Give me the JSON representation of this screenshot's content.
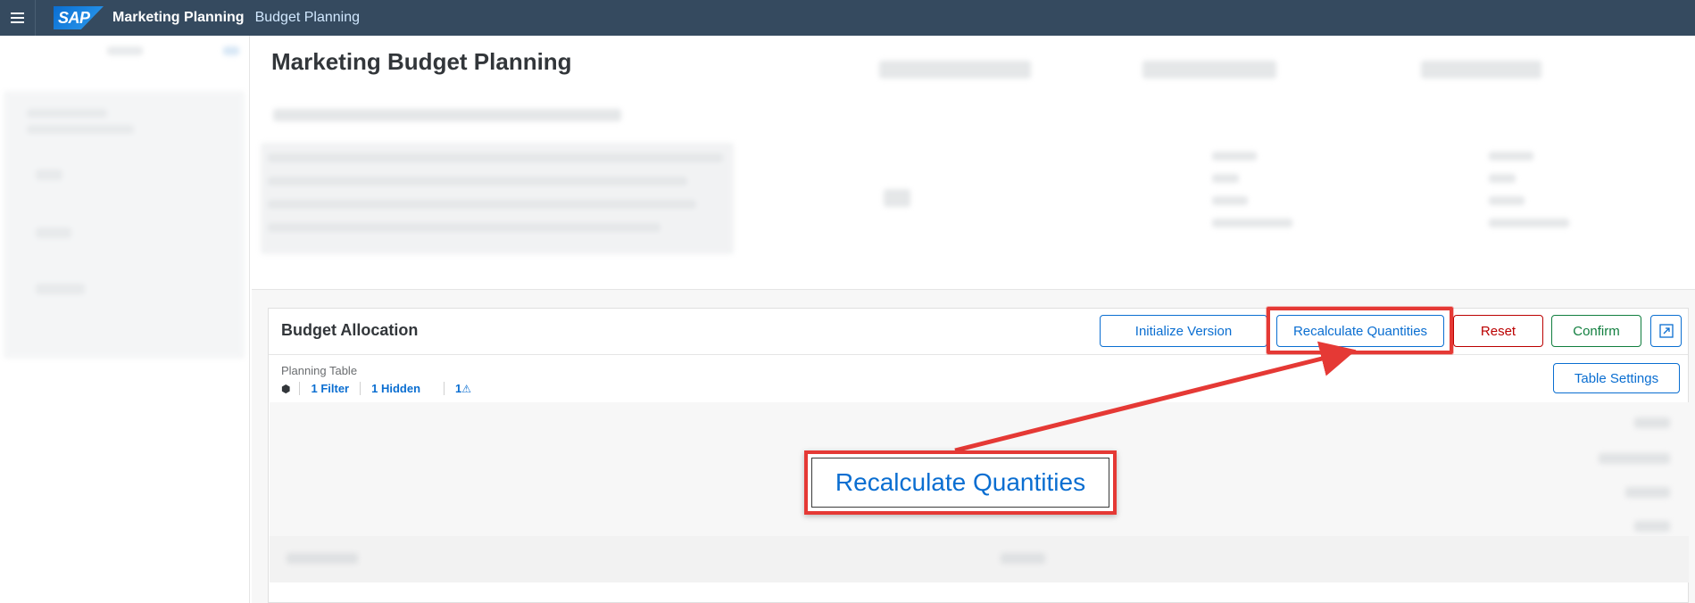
{
  "shellbar": {
    "logo_text": "SAP",
    "app_title": "Marketing Planning",
    "app_subtitle": "Budget Planning"
  },
  "page": {
    "title": "Marketing Budget Planning"
  },
  "budget_allocation": {
    "title": "Budget Allocation",
    "buttons": {
      "initialize": "Initialize Version",
      "recalculate": "Recalculate Quantities",
      "reset": "Reset",
      "confirm": "Confirm",
      "table_settings": "Table Settings"
    },
    "planning_table_label": "Planning Table",
    "toolbar": {
      "filter": "1 Filter",
      "hidden": "1 Hidden",
      "warnings": "1"
    }
  },
  "callout": {
    "text": "Recalculate Quantities"
  },
  "colors": {
    "shellbar_bg": "#354a5f",
    "accent_blue": "#0a6ed1",
    "reset_red": "#bb0000",
    "confirm_green": "#107e3e",
    "highlight_red": "#e53935"
  }
}
